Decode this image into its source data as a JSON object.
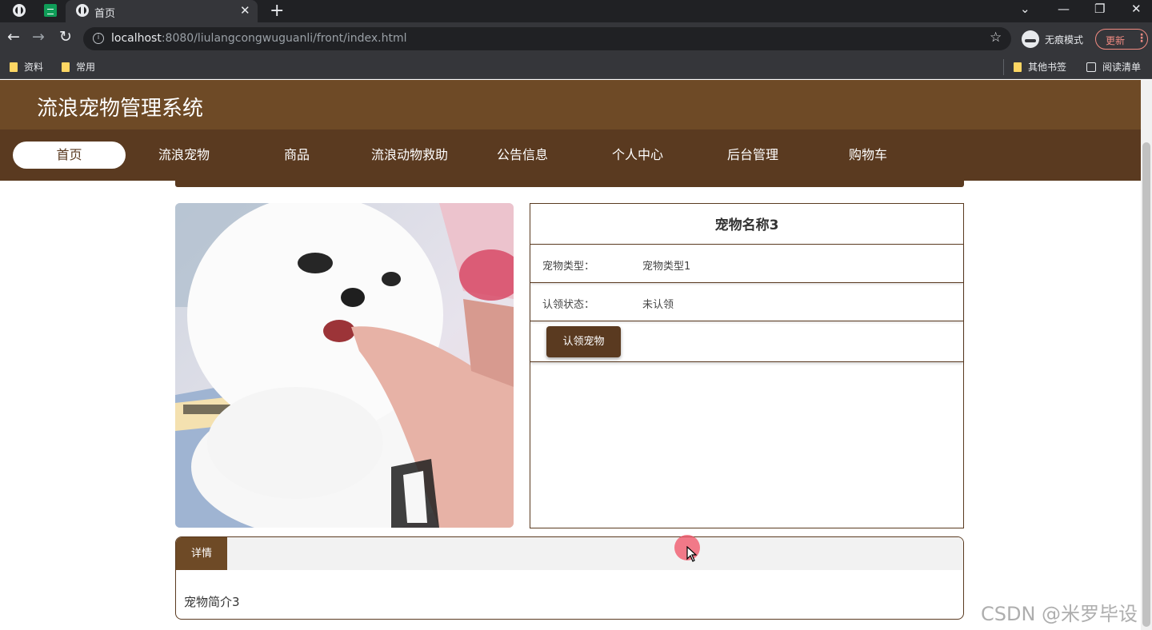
{
  "browser": {
    "tab_title": "首页",
    "url_host": "localhost",
    "url_rest": ":8080/liulangcongwuguanli/front/index.html",
    "incognito_label": "无痕模式",
    "update_label": "更新",
    "bookmarks": [
      "资料",
      "常用"
    ],
    "other_bookmarks": "其他书签",
    "reading_list": "阅读清单"
  },
  "site": {
    "title": "流浪宠物管理系统",
    "nav": [
      "首页",
      "流浪宠物",
      "商品",
      "流浪动物救助",
      "公告信息",
      "个人中心",
      "后台管理",
      "购物车"
    ],
    "active_nav": "首页"
  },
  "pet": {
    "name": "宠物名称3",
    "type_label": "宠物类型：",
    "type_value": "宠物类型1",
    "status_label": "认领状态：",
    "status_value": "未认领",
    "adopt_button": "认领宠物"
  },
  "details": {
    "tab_label": "详情",
    "intro": "宠物简介3"
  },
  "watermark": "CSDN @米罗毕设",
  "colors": {
    "header_brown": "#6e4a26",
    "nav_brown": "#5a3a20",
    "chrome_dark": "#202124",
    "chrome_mid": "#35363a"
  }
}
